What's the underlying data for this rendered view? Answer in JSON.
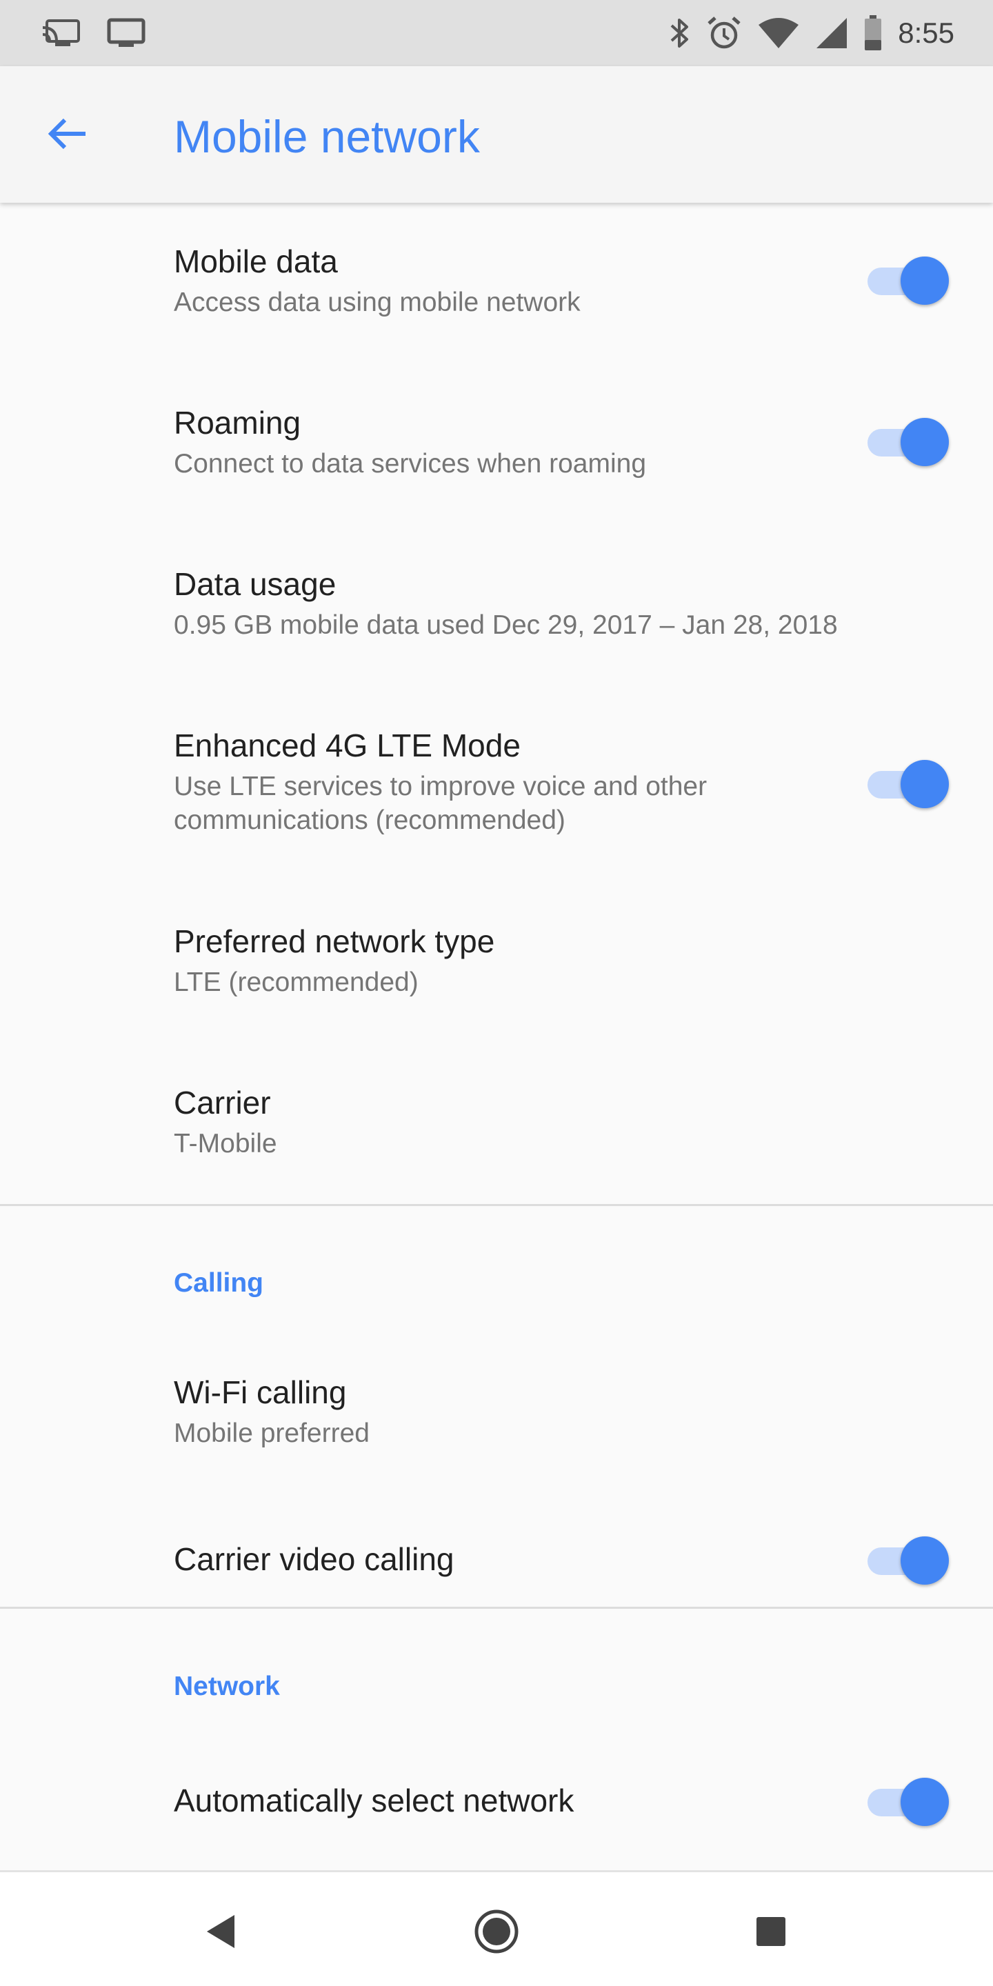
{
  "status_bar": {
    "time": "8:55",
    "left_icons": [
      "cast-icon",
      "monitor-icon"
    ],
    "right_icons": [
      "bluetooth-icon",
      "alarm-icon",
      "wifi-icon",
      "signal-icon",
      "battery-icon"
    ]
  },
  "app_bar": {
    "title": "Mobile network",
    "accent_color": "#4285f4"
  },
  "items": {
    "mobile_data": {
      "title": "Mobile data",
      "summary": "Access data using mobile network",
      "toggle": true
    },
    "roaming": {
      "title": "Roaming",
      "summary": "Connect to data services when roaming",
      "toggle": true
    },
    "data_usage": {
      "title": "Data usage",
      "summary": "0.95 GB mobile data used Dec 29, 2017 – Jan 28, 2018"
    },
    "lte_mode": {
      "title": "Enhanced 4G LTE Mode",
      "summary": "Use LTE services to improve voice and other communications (recommended)",
      "toggle": true
    },
    "network_type": {
      "title": "Preferred network type",
      "summary": "LTE (recommended)"
    },
    "carrier": {
      "title": "Carrier",
      "summary": "T-Mobile"
    }
  },
  "calling": {
    "header": "Calling",
    "wifi_calling": {
      "title": "Wi-Fi calling",
      "summary": "Mobile preferred"
    },
    "video_calling": {
      "title": "Carrier video calling",
      "toggle": true
    }
  },
  "network": {
    "header": "Network",
    "auto_select": {
      "title": "Automatically select network",
      "toggle": true
    }
  },
  "nav_bar": {
    "icons": [
      "back-triangle-icon",
      "home-circle-icon",
      "recents-square-icon"
    ]
  }
}
